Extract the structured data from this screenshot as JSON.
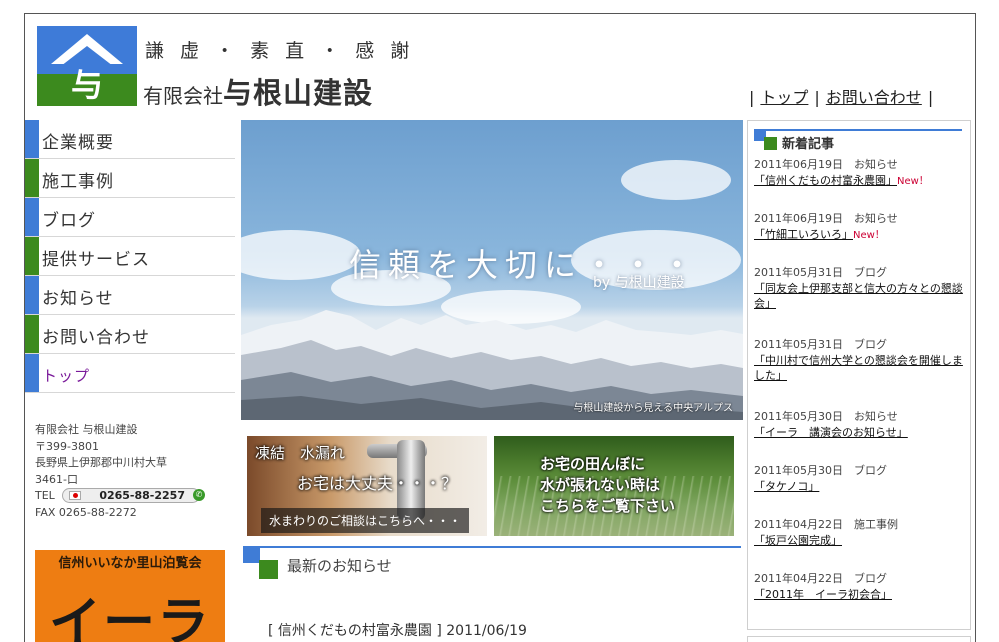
{
  "header": {
    "motto": "謙 虚 ・ 素 直 ・ 感 謝",
    "company_prefix": "有限会社",
    "company_name": "与根山建設",
    "logo_char": "与"
  },
  "top_nav": {
    "items": [
      {
        "label": "トップ"
      },
      {
        "label": "お問い合わせ"
      }
    ]
  },
  "left_nav": {
    "items": [
      {
        "label": "企業概要",
        "accent": "#3f7cd6"
      },
      {
        "label": "施工事例",
        "accent": "#3c8a1e"
      },
      {
        "label": "ブログ",
        "accent": "#3f7cd6"
      },
      {
        "label": "提供サービス",
        "accent": "#3c8a1e"
      },
      {
        "label": "お知らせ",
        "accent": "#3f7cd6"
      },
      {
        "label": "お問い合わせ",
        "accent": "#3c8a1e"
      },
      {
        "label": "トップ",
        "accent": "#3f7cd6"
      }
    ]
  },
  "company_info": {
    "name": "有限会社 与根山建設",
    "postal": "〒399-3801",
    "address1": "長野県上伊那郡中川村大草",
    "address2": "3461-口",
    "tel_label": "TEL",
    "tel": "0265-88-2257",
    "fax": "FAX 0265-88-2272"
  },
  "banner": {
    "title": "信州いいなか里山泊覧会",
    "logo_text": "イーラ"
  },
  "hero": {
    "slogan": "信頼を大切に・・・",
    "by": "by 与根山建設",
    "caption": "与根山建設から見える中央アルプス"
  },
  "promos": {
    "water": {
      "line1": "凍結　水漏れ",
      "line2": "お宅は大丈夫・・・？",
      "line3": "水まわりのご相談はこちらへ・・・"
    },
    "field": {
      "line1": "お宅の田んぼに",
      "line2": "水が張れない時は",
      "line3": "こちらをご覧下さい"
    }
  },
  "news": {
    "heading": "最新のお知らせ",
    "first_item": "[ 信州くだもの村富永農園 ] 2011/06/19"
  },
  "sidebar": {
    "heading": "新着記事",
    "entries": [
      {
        "meta": "2011年06月19日　お知らせ",
        "title": "「信州くだもの村富永農園」",
        "new": "New！"
      },
      {
        "meta": "2011年06月19日　お知らせ",
        "title": "「竹細工いろいろ」",
        "new": "New！"
      },
      {
        "meta": "2011年05月31日　ブログ",
        "title": "「同友会上伊那支部と信大の方々との懇談会」",
        "new": ""
      },
      {
        "meta": "2011年05月31日　ブログ",
        "title": "「中川村で信州大学との懇談会を開催しました」",
        "new": ""
      },
      {
        "meta": "2011年05月30日　お知らせ",
        "title": "「イーラ　講演会のお知らせ」",
        "new": ""
      },
      {
        "meta": "2011年05月30日　ブログ",
        "title": "「タケノコ」",
        "new": ""
      },
      {
        "meta": "2011年04月22日　施工事例",
        "title": "「坂戸公園完成」",
        "new": ""
      },
      {
        "meta": "2011年04月22日　ブログ",
        "title": "「2011年　イーラ初会合」",
        "new": ""
      }
    ]
  },
  "colors": {
    "accent_blue": "#3f7cd6",
    "accent_green": "#3c8a1e",
    "active_nav": "#7a1a9a",
    "banner_orange": "#ee7d12"
  }
}
